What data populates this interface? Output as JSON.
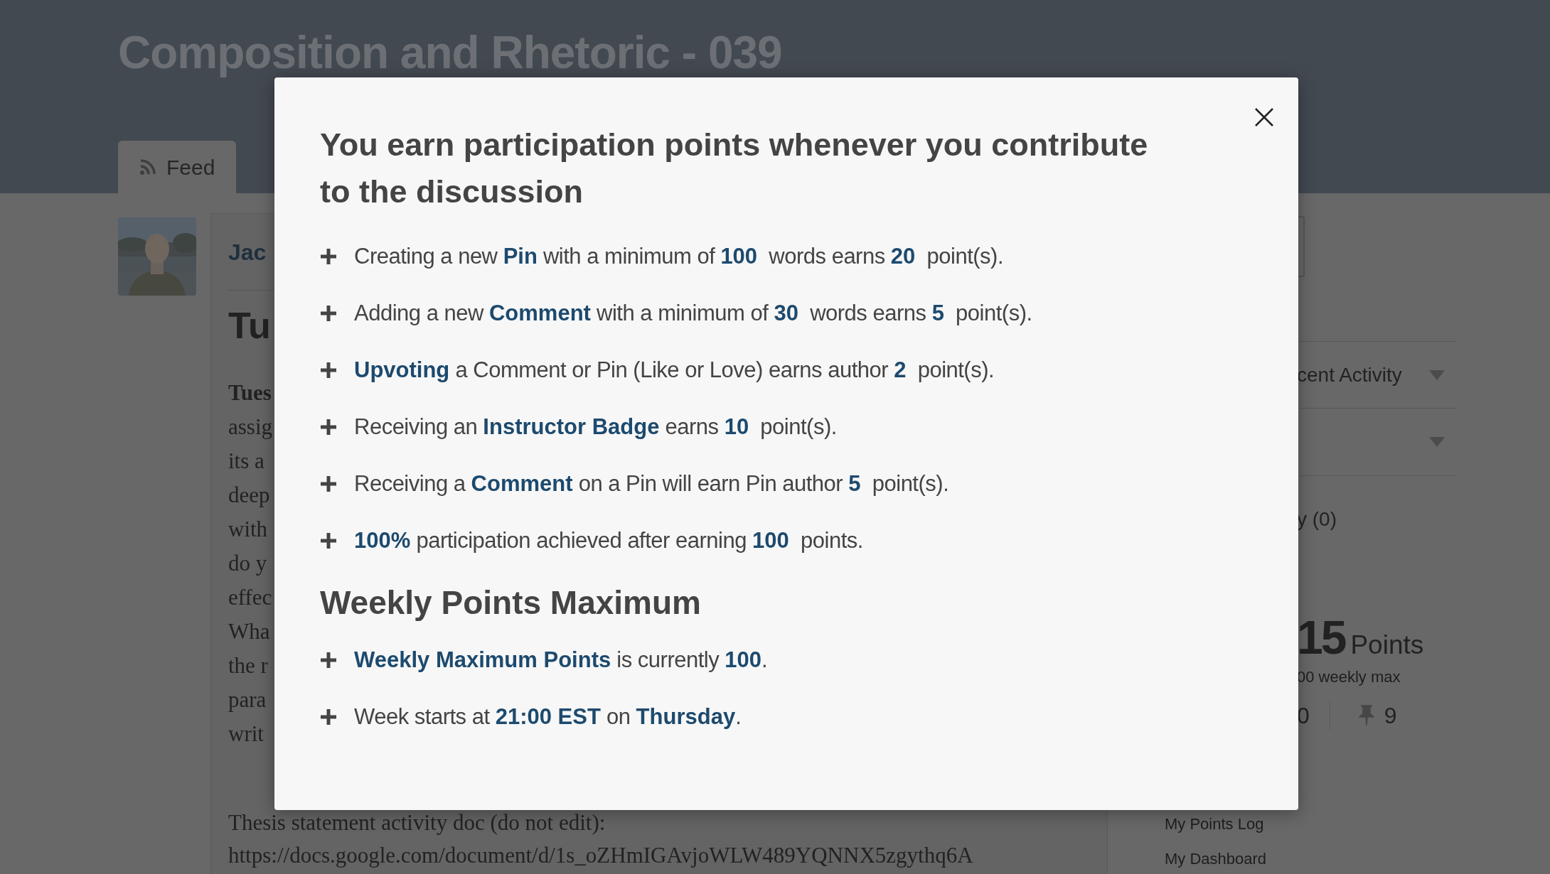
{
  "page": {
    "course_title": "Composition and Rhetoric - 039",
    "tabs": [
      {
        "label": "Feed",
        "selected": true
      }
    ],
    "post": {
      "author": "Jac",
      "title": "Tu",
      "body_lines": [
        "Tues",
        "assig",
        "its a",
        "deep",
        "with",
        "do y",
        "effec",
        "Wha",
        "the r",
        "para",
        "writ"
      ],
      "thesis_label": "Thesis statement activity doc (do not edit):",
      "url": "https://docs.google.com/document/d/1s_oZHmIGAvjoWLW489YQNNX5zgythq6A"
    },
    "sidebar": {
      "filters": [
        "cent Activity"
      ],
      "count_text": "y (0)",
      "points_value": "15",
      "points_label": "Points",
      "weekly_max": "00 weekly max",
      "stats": [
        "0",
        "9"
      ],
      "links": [
        "My Points Log",
        "My Dashboard"
      ]
    }
  },
  "modal": {
    "title": "You earn participation points whenever you contribute to the discussion",
    "rules": [
      "Creating a new **Pin** with a minimum of **100**  words earns **20**  point(s).",
      "Adding a new **Comment** with a minimum of **30**  words earns **5**  point(s).",
      "**Upvoting** a Comment or Pin (Like or Love) earns author **2**  point(s).",
      "Receiving an **Instructor Badge** earns **10**  point(s).",
      "Receiving a **Comment** on a Pin will earn Pin author **5**  point(s).",
      "**100%** participation achieved after earning **100**  points."
    ],
    "weekly_heading": "Weekly Points Maximum",
    "weekly_rules": [
      "**Weekly Maximum Points** is currently **100**.",
      "Week starts at **21:00 EST** on **Thursday**."
    ]
  }
}
